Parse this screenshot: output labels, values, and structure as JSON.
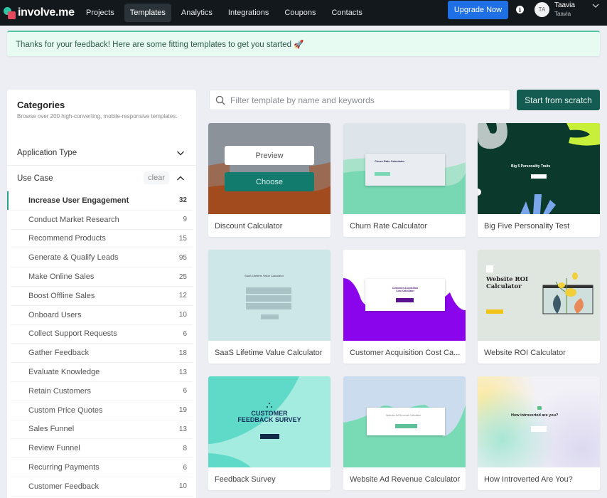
{
  "nav": {
    "brand": "involve.me",
    "items": [
      {
        "label": "Projects",
        "active": false
      },
      {
        "label": "Templates",
        "active": true
      },
      {
        "label": "Analytics",
        "active": false
      },
      {
        "label": "Integrations",
        "active": false
      },
      {
        "label": "Coupons",
        "active": false
      },
      {
        "label": "Contacts",
        "active": false
      }
    ],
    "upgrade_label": "Upgrade Now",
    "info_icon": "i",
    "user": {
      "initials": "TA",
      "name": "Taavia",
      "workspace": "Taavia"
    }
  },
  "banner": {
    "text": "Thanks for your feedback! Here are some fitting templates to get you started 🚀"
  },
  "sidebar": {
    "title": "Categories",
    "subtitle": "Browse over 200 high-converting, mobile-responsive templates.",
    "application_type": {
      "label": "Application Type",
      "expanded": false
    },
    "use_case": {
      "label": "Use Case",
      "clear_label": "clear",
      "expanded": true,
      "items": [
        {
          "label": "Increase User Engagement",
          "count": "32",
          "active": true
        },
        {
          "label": "Conduct Market Research",
          "count": "9"
        },
        {
          "label": "Recommend Products",
          "count": "15"
        },
        {
          "label": "Generate & Qualify Leads",
          "count": "95"
        },
        {
          "label": "Make Online Sales",
          "count": "25"
        },
        {
          "label": "Boost Offline Sales",
          "count": "12"
        },
        {
          "label": "Onboard Users",
          "count": "10"
        },
        {
          "label": "Collect Support Requests",
          "count": "6"
        },
        {
          "label": "Gather Feedback",
          "count": "18"
        },
        {
          "label": "Evaluate Knowledge",
          "count": "13"
        },
        {
          "label": "Retain Customers",
          "count": "6"
        },
        {
          "label": "Custom Price Quotes",
          "count": "19"
        },
        {
          "label": "Sales Funnel",
          "count": "13"
        },
        {
          "label": "Review Funnel",
          "count": "8"
        },
        {
          "label": "Recurring Payments",
          "count": "6"
        },
        {
          "label": "Customer Feedback",
          "count": "10"
        }
      ]
    }
  },
  "search": {
    "placeholder": "Filter template by name and keywords",
    "value": ""
  },
  "scratch_label": "Start from scratch",
  "templates": [
    {
      "title": "Discount Calculator",
      "preview_label": "Preview",
      "choose_label": "Choose"
    },
    {
      "title": "Churn Rate Calculator",
      "thumb_text": "Churn Rate Calculator"
    },
    {
      "title": "Big Five Personality Test",
      "thumb_text": "Big 5 Personality Traits"
    },
    {
      "title": "SaaS Lifetime Value Calculator",
      "thumb_text": "SaaS Lifetime Value Calculator"
    },
    {
      "title": "Customer Acquisition Cost Ca...",
      "thumb_text": "Customer Acquisition Cost Calculator"
    },
    {
      "title": "Website ROI Calculator",
      "thumb_text": "Website ROI Calculator"
    },
    {
      "title": "Feedback Survey",
      "thumb_text": "CUSTOMER FEEDBACK SURVEY"
    },
    {
      "title": "Website Ad Revenue Calculator",
      "thumb_text": "Website Ad Revenue Calculator"
    },
    {
      "title": "How Introverted Are You?",
      "thumb_text": "How introverted are you?"
    }
  ],
  "colors": {
    "nav_bg": "#13181c",
    "upgrade": "#1f6fe5",
    "accent_green": "#145c52",
    "banner_bg": "#e8fbf3",
    "active_marker": "#2aa08b"
  }
}
